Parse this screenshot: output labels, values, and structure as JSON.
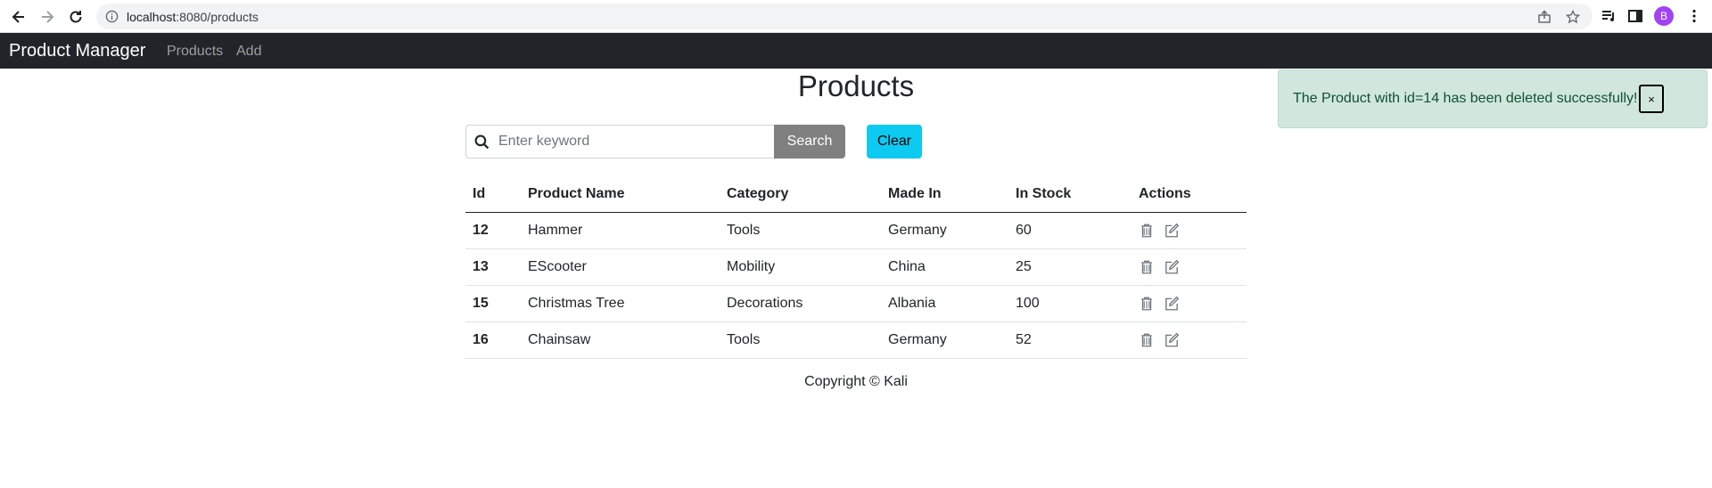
{
  "browser": {
    "url_host": "localhost",
    "url_path": ":8080/products",
    "avatar_letter": "B"
  },
  "navbar": {
    "brand": "Product Manager",
    "links": [
      "Products",
      "Add"
    ]
  },
  "page": {
    "title": "Products"
  },
  "search": {
    "placeholder": "Enter keyword",
    "value": "",
    "button_label": "Search",
    "clear_label": "Clear"
  },
  "table": {
    "headers": [
      "Id",
      "Product Name",
      "Category",
      "Made In",
      "In Stock",
      "Actions"
    ],
    "rows": [
      {
        "id": "12",
        "name": "Hammer",
        "category": "Tools",
        "made_in": "Germany",
        "stock": "60"
      },
      {
        "id": "13",
        "name": "EScooter",
        "category": "Mobility",
        "made_in": "China",
        "stock": "25"
      },
      {
        "id": "15",
        "name": "Christmas Tree",
        "category": "Decorations",
        "made_in": "Albania",
        "stock": "100"
      },
      {
        "id": "16",
        "name": "Chainsaw",
        "category": "Tools",
        "made_in": "Germany",
        "stock": "52"
      }
    ],
    "action_icons": [
      "trash-icon",
      "edit-icon"
    ]
  },
  "footer": {
    "text": "Copyright © Kali"
  },
  "toast": {
    "message": "The Product with id=14 has been deleted successfully!",
    "close_label": "×",
    "color": "#d1e7dd"
  },
  "colors": {
    "navbar_bg": "#212529",
    "search_button": "#808080",
    "clear_button": "#0dcaf0",
    "avatar": "#a142f4"
  }
}
